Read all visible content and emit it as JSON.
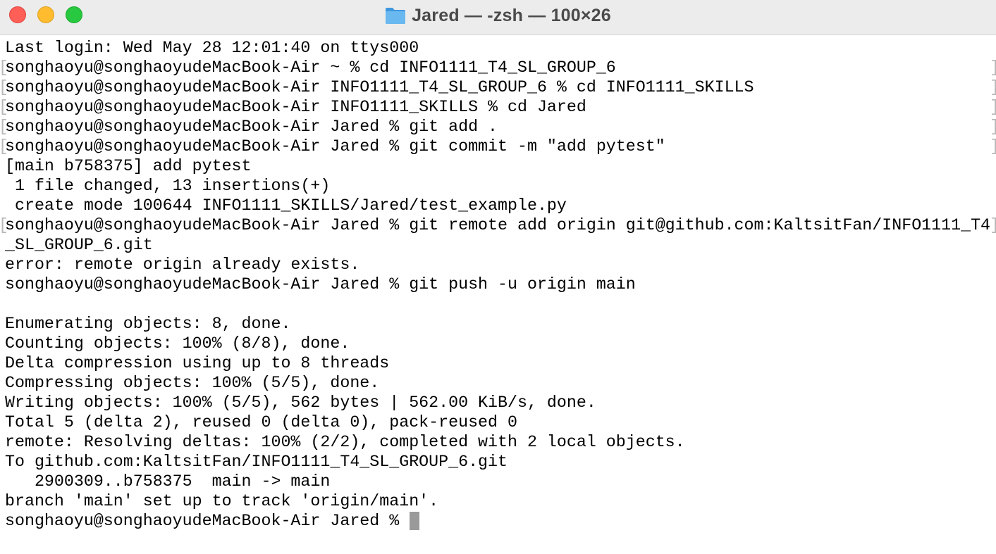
{
  "window": {
    "title": "Jared — -zsh — 100×26",
    "folder_icon": "folder-icon",
    "folder_color": "#5aaeea"
  },
  "terminal": {
    "lines": [
      {
        "text": "Last login: Wed May 28 12:01:40 on ttys000",
        "marked": false
      },
      {
        "text": "songhaoyu@songhaoyudeMacBook-Air ~ % cd INFO1111_T4_SL_GROUP_6",
        "marked": true
      },
      {
        "text": "songhaoyu@songhaoyudeMacBook-Air INFO1111_T4_SL_GROUP_6 % cd INFO1111_SKILLS",
        "marked": true
      },
      {
        "text": "songhaoyu@songhaoyudeMacBook-Air INFO1111_SKILLS % cd Jared",
        "marked": true
      },
      {
        "text": "songhaoyu@songhaoyudeMacBook-Air Jared % git add .",
        "marked": true
      },
      {
        "text": "songhaoyu@songhaoyudeMacBook-Air Jared % git commit -m \"add pytest\"",
        "marked": true
      },
      {
        "text": "[main b758375] add pytest",
        "marked": false
      },
      {
        "text": " 1 file changed, 13 insertions(+)",
        "marked": false
      },
      {
        "text": " create mode 100644 INFO1111_SKILLS/Jared/test_example.py",
        "marked": false
      },
      {
        "text": "songhaoyu@songhaoyudeMacBook-Air Jared % git remote add origin git@github.com:KaltsitFan/INFO1111_T4",
        "marked": true
      },
      {
        "text": "_SL_GROUP_6.git",
        "marked": false
      },
      {
        "text": "error: remote origin already exists.",
        "marked": false
      },
      {
        "text": "songhaoyu@songhaoyudeMacBook-Air Jared % git push -u origin main",
        "marked": false
      },
      {
        "text": "",
        "marked": false
      },
      {
        "text": "Enumerating objects: 8, done.",
        "marked": false
      },
      {
        "text": "Counting objects: 100% (8/8), done.",
        "marked": false
      },
      {
        "text": "Delta compression using up to 8 threads",
        "marked": false
      },
      {
        "text": "Compressing objects: 100% (5/5), done.",
        "marked": false
      },
      {
        "text": "Writing objects: 100% (5/5), 562 bytes | 562.00 KiB/s, done.",
        "marked": false
      },
      {
        "text": "Total 5 (delta 2), reused 0 (delta 0), pack-reused 0",
        "marked": false
      },
      {
        "text": "remote: Resolving deltas: 100% (2/2), completed with 2 local objects.",
        "marked": false
      },
      {
        "text": "To github.com:KaltsitFan/INFO1111_T4_SL_GROUP_6.git",
        "marked": false
      },
      {
        "text": "   2900309..b758375  main -> main",
        "marked": false
      },
      {
        "text": "branch 'main' set up to track 'origin/main'.",
        "marked": false
      },
      {
        "text": "songhaoyu@songhaoyudeMacBook-Air Jared % ",
        "marked": false
      }
    ],
    "mark_left": "[",
    "mark_right": "]",
    "cursor_color": "#9a9a9a"
  }
}
